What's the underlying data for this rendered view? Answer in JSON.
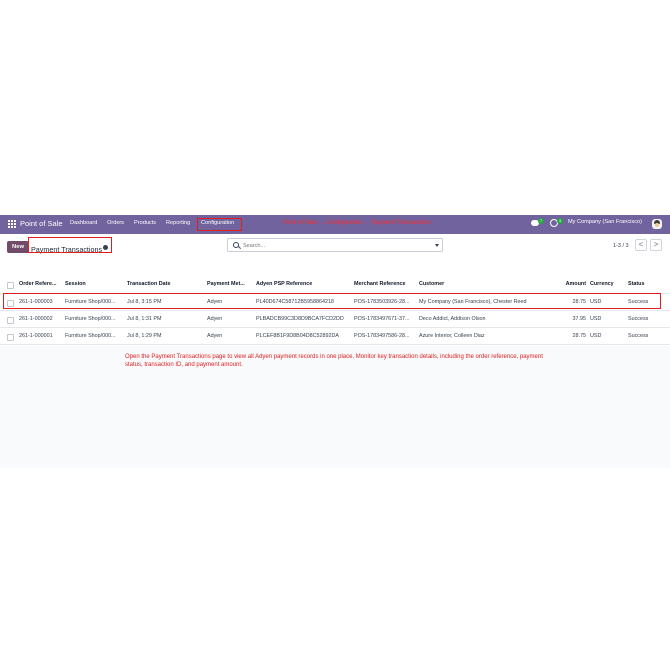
{
  "navbar": {
    "brand": "Point of Sale",
    "menu": [
      "Dashboard",
      "Orders",
      "Products",
      "Reporting",
      "Configuration"
    ],
    "annotation": "Point of Sale → Configuration → Payment Transactions",
    "chat_count": "7",
    "activity_count": "4",
    "company": "My Company (San Francisco)",
    "icons": [
      "apps-grid-icon",
      "chat-icon",
      "clock-icon",
      "avatar"
    ],
    "color": "#71639e"
  },
  "control": {
    "new_label": "New",
    "breadcrumb": "Payment Transactions",
    "search_placeholder": "Search...",
    "pager": "1-3 / 3",
    "prev": "<",
    "next": ">"
  },
  "table": {
    "columns": [
      "Order Refere...",
      "Session",
      "Transaction Date",
      "Payment Met...",
      "Adyen PSP Reference",
      "Merchant Reference",
      "Customer",
      "Amount",
      "Currency",
      "Status"
    ],
    "rows": [
      [
        "261-1-000003",
        "Furniture Shop/000...",
        "Jul 8, 3:15 PM",
        "Adyen",
        "PL40D674C58712B5958864218",
        "POS-1783503926-28...",
        "My Company (San Francisco), Chester Reed",
        "28.75",
        "USD",
        "Success"
      ],
      [
        "261-1-000002",
        "Furniture Shop/000...",
        "Jul 8, 1:31 PM",
        "Adyen",
        "PLBADCB99C3D8D9BCA7FCD2DD",
        "POS-1783497671-37...",
        "Deco Addict, Addison Olson",
        "37.95",
        "USD",
        "Success"
      ],
      [
        "261-1-000001",
        "Furniture Shop/000...",
        "Jul 8, 1:29 PM",
        "Adyen",
        "PLCEF8B1F9D8B04D8C52892DA",
        "POS-1783497586-28...",
        "Azure Interior, Colleen Diaz",
        "28.75",
        "USD",
        "Success"
      ]
    ]
  },
  "instruction": "Open the Payment Transactions page to view all Adyen payment records in one place. Monitor key transaction details, including the order reference, payment status, transaction ID, and payment amount.",
  "colors": {
    "accent": "#714b67",
    "annotation": "#e11d1d"
  }
}
